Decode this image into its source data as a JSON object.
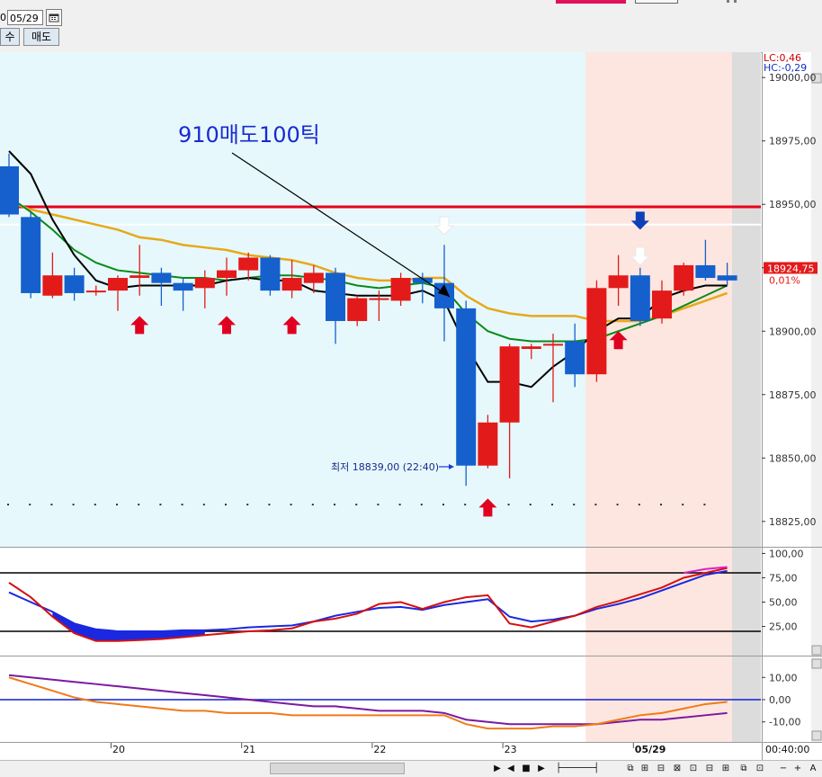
{
  "toolbar": {
    "date_lead": "0",
    "date_value": "05/29",
    "buy_label": "수",
    "sell_label": "매도"
  },
  "chart_data": {
    "type": "candlestick",
    "symbol_price_axis": {
      "ylim": [
        18815,
        19010
      ],
      "tick_labels": [
        "19000,00",
        "18975,00",
        "18950,00",
        "18925,00",
        "18900,00",
        "18875,00",
        "18850,00",
        "18825,00"
      ],
      "tick_values": [
        19000,
        18975,
        18950,
        18925,
        18900,
        18875,
        18850,
        18825
      ]
    },
    "x_labels": [
      "20",
      "21",
      "22",
      "23",
      "05/29"
    ],
    "x_label_candle_index": [
      5,
      11,
      17,
      23,
      29
    ],
    "time_readout": "00:40:00",
    "info_labels": {
      "lc": "LC:0,46",
      "hc": "HC:-0,29"
    },
    "last_price_label": "18924,75",
    "last_change_label": "0,01%",
    "last_price": 18924.75,
    "annotation_text": "910매도100틱",
    "low_label": "최저 18839,00 (22:40)",
    "low_value": 18839,
    "resistance_line": 18949,
    "white_line": 18942,
    "candles": [
      {
        "o": 18965,
        "c": 18946,
        "h": 18970,
        "l": 18945
      },
      {
        "o": 18945,
        "c": 18915,
        "h": 18947,
        "l": 18913
      },
      {
        "o": 18914,
        "c": 18922,
        "h": 18931,
        "l": 18913
      },
      {
        "o": 18922,
        "c": 18915,
        "h": 18925,
        "l": 18912
      },
      {
        "o": 18916,
        "c": 18916,
        "h": 18918,
        "l": 18914
      },
      {
        "o": 18916,
        "c": 18921,
        "h": 18922,
        "l": 18908
      },
      {
        "o": 18921,
        "c": 18922,
        "h": 18934,
        "l": 18914
      },
      {
        "o": 18923,
        "c": 18919,
        "h": 18925,
        "l": 18910
      },
      {
        "o": 18919,
        "c": 18916,
        "h": 18921,
        "l": 18908
      },
      {
        "o": 18917,
        "c": 18921,
        "h": 18924,
        "l": 18909
      },
      {
        "o": 18921,
        "c": 18924,
        "h": 18929,
        "l": 18914
      },
      {
        "o": 18924,
        "c": 18929,
        "h": 18931,
        "l": 18920
      },
      {
        "o": 18929,
        "c": 18916,
        "h": 18930,
        "l": 18914
      },
      {
        "o": 18916,
        "c": 18921,
        "h": 18928,
        "l": 18913
      },
      {
        "o": 18919,
        "c": 18923,
        "h": 18926,
        "l": 18915
      },
      {
        "o": 18923,
        "c": 18904,
        "h": 18925,
        "l": 18895
      },
      {
        "o": 18904,
        "c": 18913,
        "h": 18914,
        "l": 18902
      },
      {
        "o": 18913,
        "c": 18913,
        "h": 18916,
        "l": 18904
      },
      {
        "o": 18912,
        "c": 18921,
        "h": 18923,
        "l": 18910
      },
      {
        "o": 18921,
        "c": 18919,
        "h": 18923,
        "l": 18911
      },
      {
        "o": 18919,
        "c": 18909,
        "h": 18934,
        "l": 18896
      },
      {
        "o": 18909,
        "c": 18847,
        "h": 18912,
        "l": 18839
      },
      {
        "o": 18847,
        "c": 18864,
        "h": 18867,
        "l": 18846
      },
      {
        "o": 18864,
        "c": 18894,
        "h": 18895,
        "l": 18842
      },
      {
        "o": 18893,
        "c": 18894,
        "h": 18895,
        "l": 18889
      },
      {
        "o": 18895,
        "c": 18895,
        "h": 18899,
        "l": 18872
      },
      {
        "o": 18896,
        "c": 18883,
        "h": 18903,
        "l": 18878
      },
      {
        "o": 18883,
        "c": 18917,
        "h": 18920,
        "l": 18880
      },
      {
        "o": 18917,
        "c": 18922,
        "h": 18930,
        "l": 18910
      },
      {
        "o": 18922,
        "c": 18904,
        "h": 18925,
        "l": 18902
      },
      {
        "o": 18905,
        "c": 18916,
        "h": 18920,
        "l": 18903
      },
      {
        "o": 18916,
        "c": 18926,
        "h": 18927,
        "l": 18914
      },
      {
        "o": 18926,
        "c": 18921,
        "h": 18936,
        "l": 18920
      },
      {
        "o": 18922,
        "c": 18920,
        "h": 18927,
        "l": 18918
      }
    ],
    "ma_black": [
      18971,
      18962,
      18944,
      18930,
      18920,
      18917,
      18918,
      18918,
      18918,
      18918,
      18920,
      18921,
      18920,
      18920,
      18916,
      18915,
      18914,
      18914,
      18914,
      18916,
      18912,
      18894,
      18880,
      18880,
      18878,
      18886,
      18892,
      18900,
      18905,
      18905,
      18913,
      18916,
      18918,
      18918
    ],
    "ma_green": [
      18953,
      18947,
      18940,
      18932,
      18927,
      18924,
      18923,
      18922,
      18921,
      18921,
      18920,
      18921,
      18922,
      18922,
      18921,
      18920,
      18918,
      18917,
      18918,
      18919,
      18917,
      18907,
      18900,
      18897,
      18896,
      18896,
      18896,
      18897,
      18900,
      18903,
      18906,
      18910,
      18914,
      18918
    ],
    "ma_orange": [
      18951,
      18948,
      18946,
      18944,
      18942,
      18940,
      18937,
      18936,
      18934,
      18933,
      18932,
      18930,
      18929,
      18928,
      18926,
      18923,
      18921,
      18920,
      18920,
      18921,
      18921,
      18914,
      18909,
      18907,
      18906,
      18906,
      18906,
      18904,
      18904,
      18904,
      18906,
      18909,
      18912,
      18915
    ],
    "buy_arrows_at": [
      6,
      10,
      13,
      22,
      28
    ],
    "sell_arrows_at": [
      29
    ],
    "white_arrows_at": [
      20,
      29
    ],
    "stochastic": {
      "ylim": [
        -5,
        105
      ],
      "tick_labels": [
        "100,00",
        "75,00",
        "50,00",
        "25,00"
      ],
      "tick_values": [
        100,
        75,
        50,
        25
      ],
      "hlines": [
        80,
        20
      ],
      "k": [
        70,
        55,
        35,
        18,
        10,
        10,
        11,
        12,
        14,
        16,
        18,
        20,
        21,
        23,
        30,
        33,
        38,
        48,
        50,
        43,
        50,
        55,
        57,
        28,
        24,
        30,
        36,
        45,
        51,
        58,
        65,
        75,
        80,
        85
      ],
      "d": [
        60,
        50,
        40,
        28,
        22,
        20,
        20,
        20,
        21,
        21,
        22,
        24,
        25,
        26,
        30,
        36,
        40,
        44,
        45,
        42,
        47,
        50,
        53,
        35,
        30,
        32,
        36,
        43,
        48,
        54,
        62,
        70,
        78,
        82
      ],
      "extra": [
        80,
        80,
        80,
        80,
        80,
        80,
        80,
        80,
        80,
        80,
        80,
        80,
        80,
        80,
        80,
        80,
        80,
        80,
        80,
        80,
        80,
        80,
        80,
        80,
        80,
        80,
        80,
        80,
        80,
        80,
        80,
        80,
        84,
        86
      ]
    },
    "oscillator": {
      "ylim": [
        -19,
        19
      ],
      "tick_labels": [
        "10,00",
        "0,00",
        "-10,00"
      ],
      "tick_values": [
        10,
        0,
        -10
      ],
      "zero_line": 0,
      "orange": [
        10,
        7,
        4,
        1,
        -1,
        -2,
        -3,
        -4,
        -5,
        -5,
        -6,
        -6,
        -6,
        -7,
        -7,
        -7,
        -7,
        -7,
        -7,
        -7,
        -7,
        -11,
        -13,
        -13,
        -13,
        -12,
        -12,
        -11,
        -9,
        -7,
        -6,
        -4,
        -2,
        -1
      ],
      "purple": [
        11,
        10,
        9,
        8,
        7,
        6,
        5,
        4,
        3,
        2,
        1,
        0,
        -1,
        -2,
        -3,
        -3,
        -4,
        -5,
        -5,
        -5,
        -6,
        -9,
        -10,
        -11,
        -11,
        -11,
        -11,
        -11,
        -10,
        -9,
        -9,
        -8,
        -7,
        -6
      ]
    }
  },
  "controls": {
    "buttons": [
      "▶",
      "◀",
      "■",
      "▶"
    ]
  }
}
